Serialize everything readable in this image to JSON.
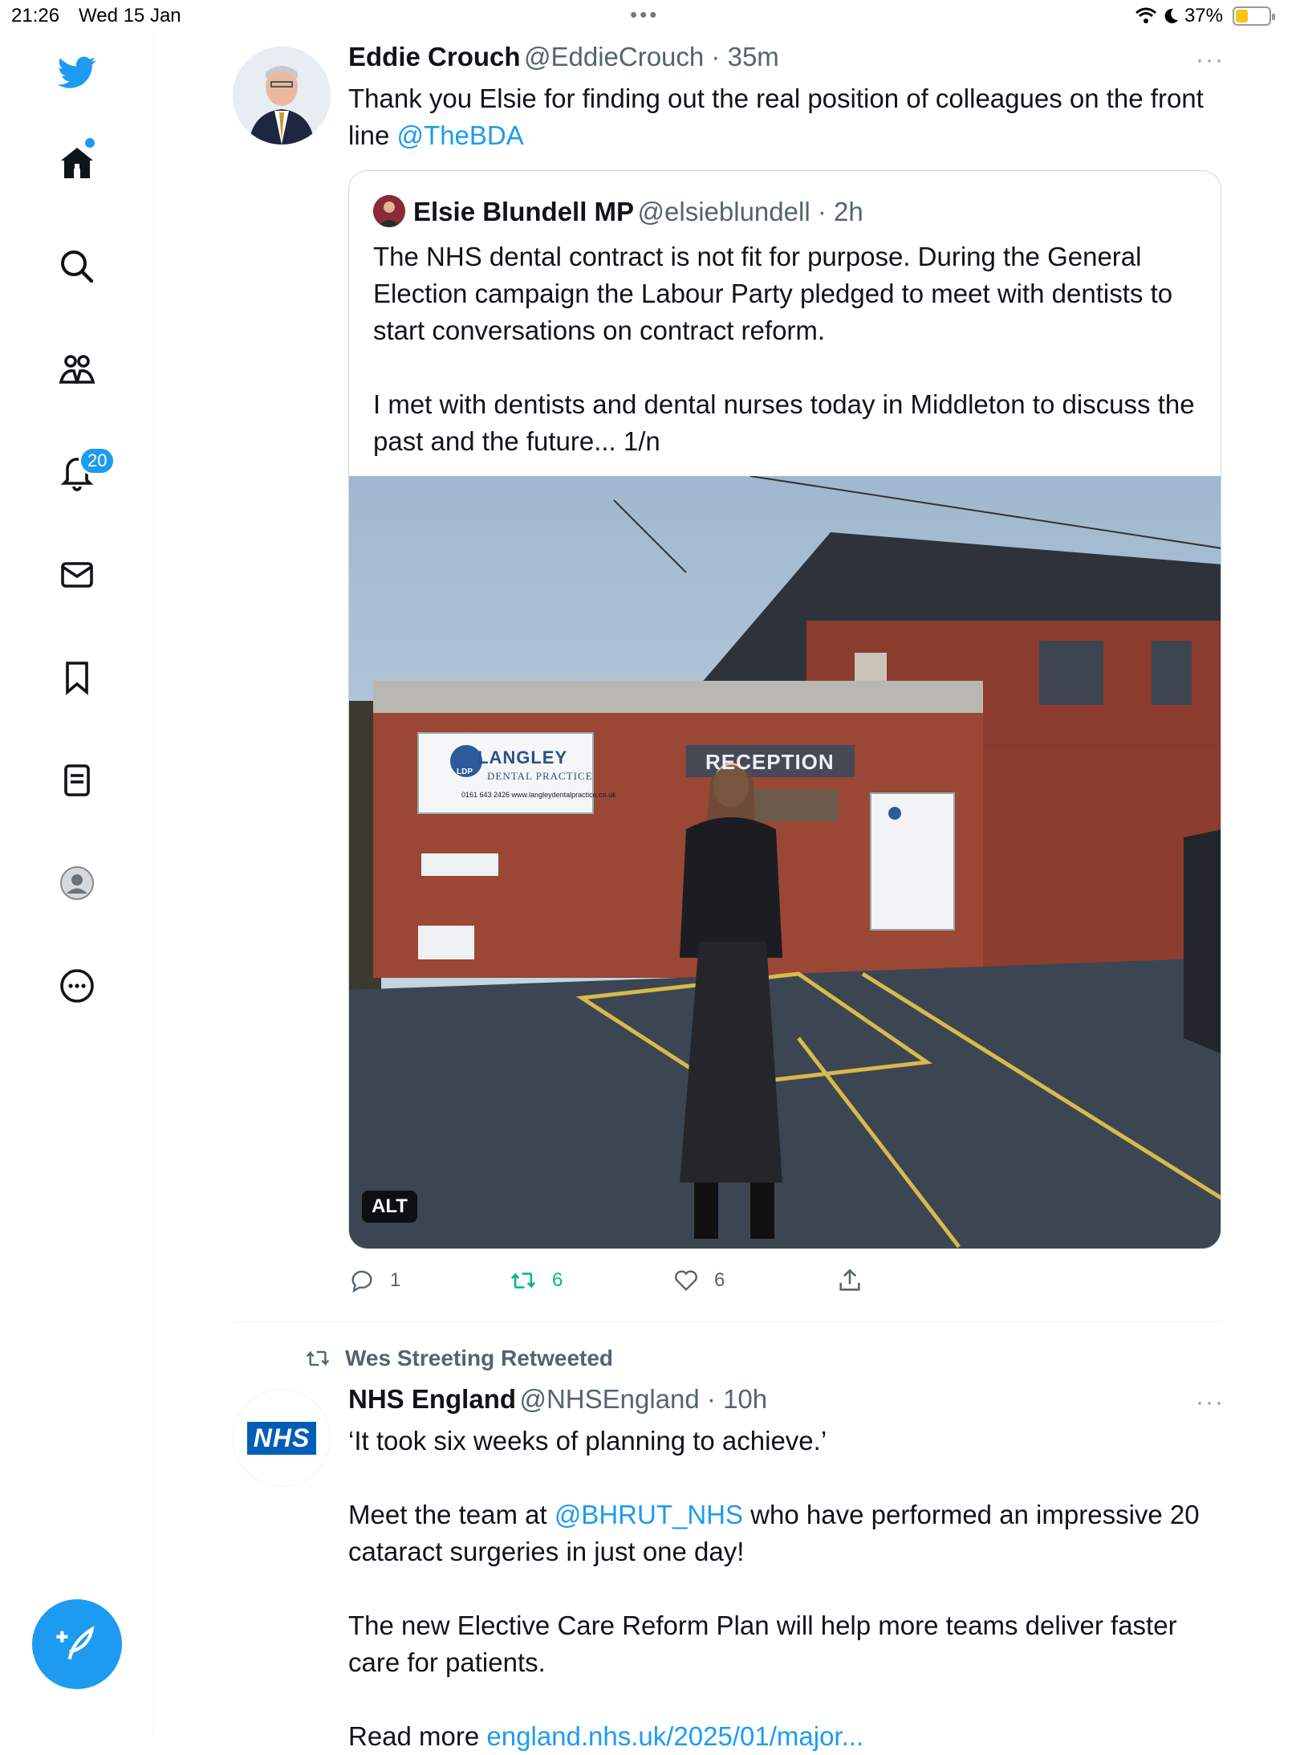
{
  "status_bar": {
    "time": "21:26",
    "date": "Wed 15 Jan",
    "battery": "37%",
    "battery_level": 0.37
  },
  "sidebar": {
    "items": [
      {
        "name": "home"
      },
      {
        "name": "search"
      },
      {
        "name": "communities"
      },
      {
        "name": "notifications",
        "badge": "20"
      },
      {
        "name": "messages"
      },
      {
        "name": "bookmarks"
      },
      {
        "name": "lists"
      },
      {
        "name": "profile"
      },
      {
        "name": "more"
      }
    ],
    "compose_icon": "feather-plus-icon",
    "accent": "#1d9bf0"
  },
  "tweet1": {
    "author": "Eddie Crouch",
    "handle": "@EddieCrouch",
    "time": "35m",
    "text_before": "Thank you Elsie for finding out the real position of colleagues on the front line ",
    "mention": "@TheBDA",
    "quote": {
      "author": "Elsie Blundell MP",
      "handle": "@elsieblundell",
      "time": "2h",
      "paragraph1": "The NHS dental contract is not fit for purpose.  During the General Election campaign the Labour Party pledged to meet with dentists to start conversations on contract reform.",
      "paragraph2": "I met with dentists and dental nurses today in Middleton to discuss the past and the future... 1/n",
      "photo": {
        "alt_badge": "ALT",
        "sign_name": "LANGLEY",
        "sign_sub": "DENTAL PRACTICE",
        "sign_logo": "LDP",
        "reception": "RECEPTION"
      }
    },
    "actions": {
      "replies": "1",
      "retweets": "6",
      "likes": "6"
    }
  },
  "tweet2": {
    "retweeted_by": "Wes Streeting Retweeted",
    "author": "NHS England",
    "handle": "@NHSEngland",
    "time": "10h",
    "avatar_text": "NHS",
    "line1": "‘It took six weeks of planning to achieve.’",
    "line2_before": "Meet the team at ",
    "line2_mention": "@BHRUT_NHS",
    "line2_after": " who have performed an impressive 20 cataract surgeries in just one day!",
    "line3": "The new Elective Care Reform Plan will help more teams deliver faster care for patients.",
    "line4_before": "Read more ",
    "line4_link": "england.nhs.uk/2025/01/major..."
  }
}
